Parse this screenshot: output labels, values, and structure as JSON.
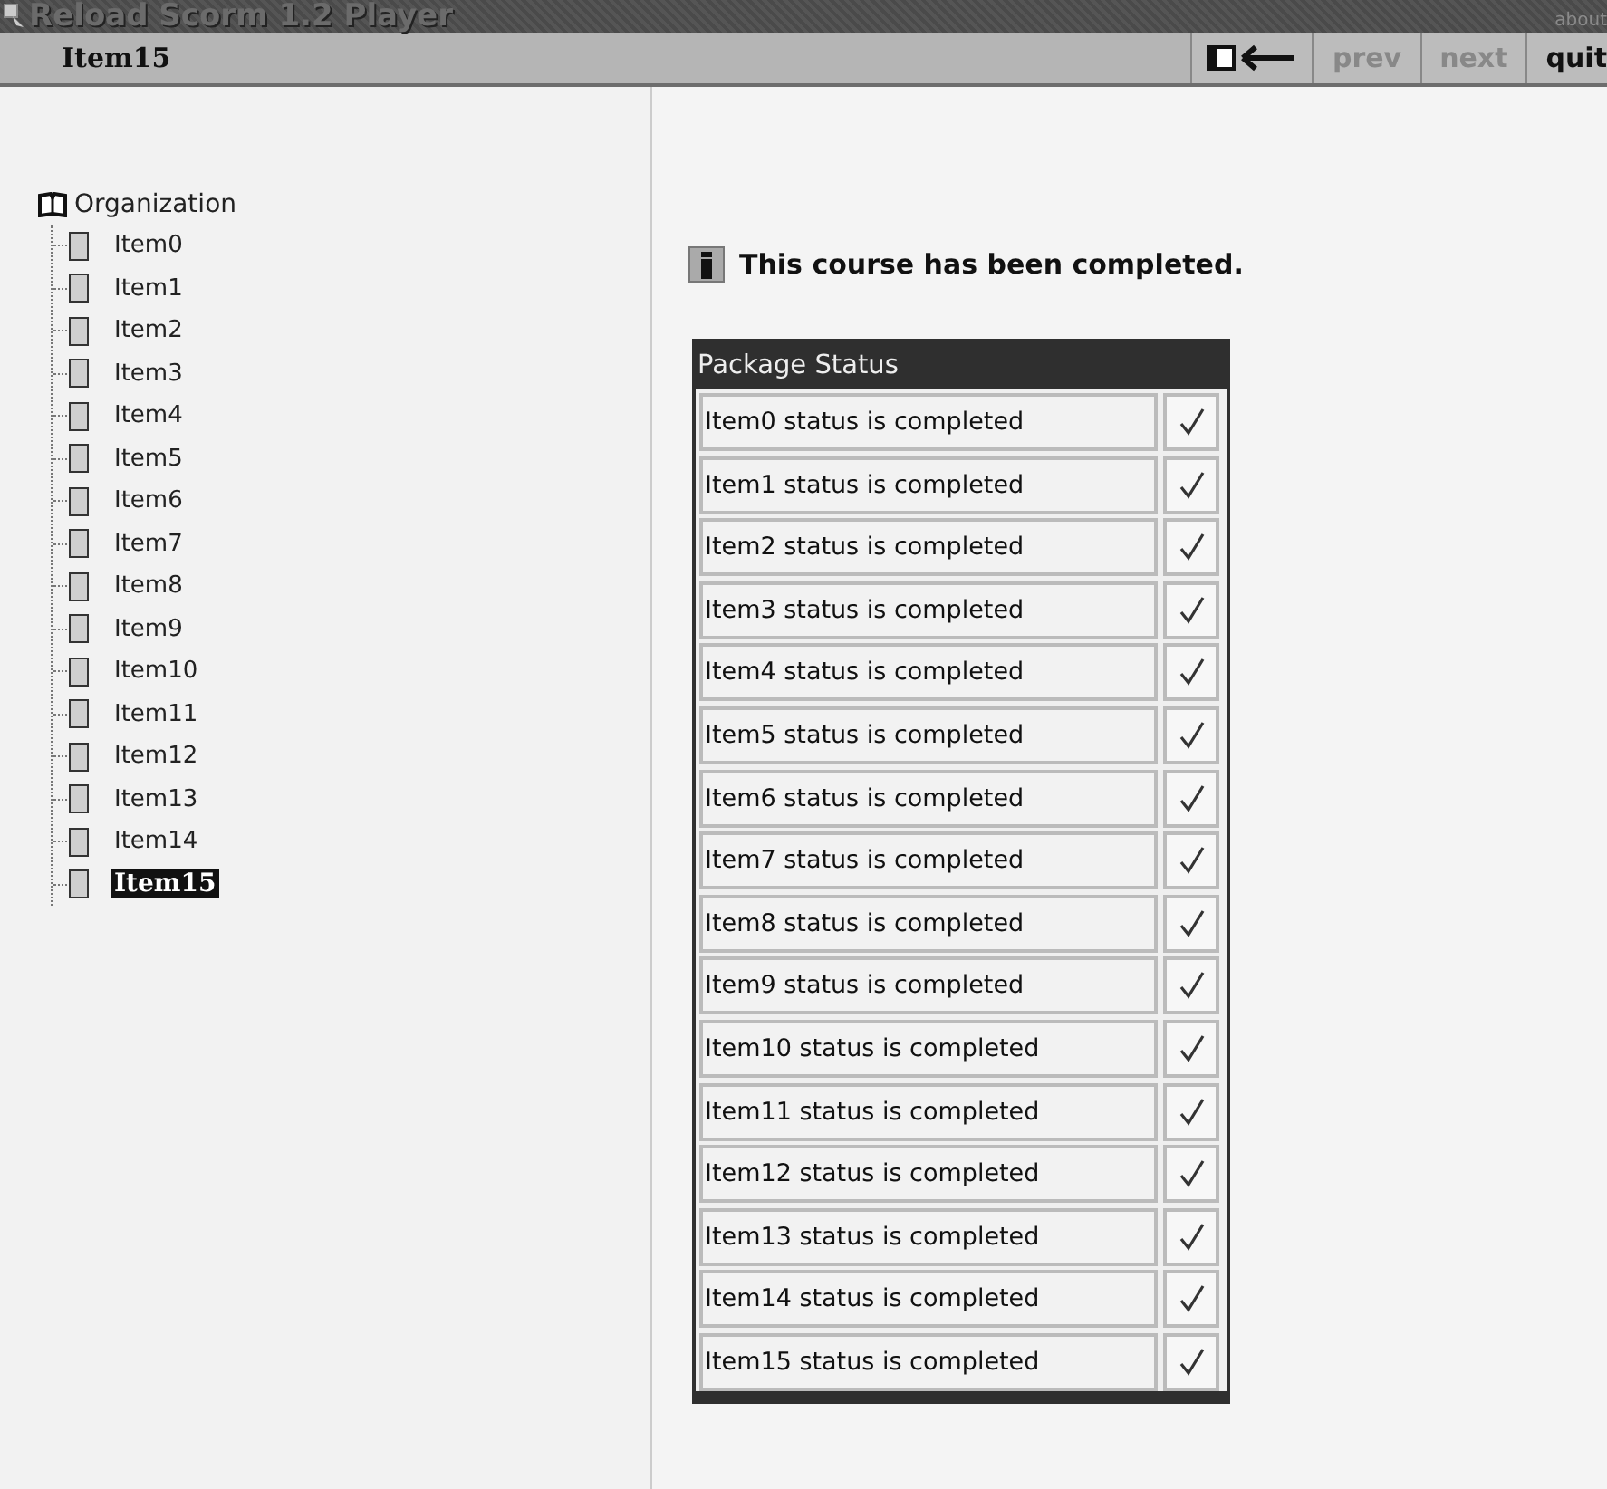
{
  "window": {
    "title": "Reload Scorm 1.2 Player",
    "about": "about"
  },
  "nav_bar": {
    "current_item": "Item15",
    "buttons": [
      "prev",
      "next",
      "quit"
    ]
  },
  "tree": {
    "label": "Organization",
    "children": [
      {
        "label": "Item0",
        "selected": false
      },
      {
        "label": "Item1",
        "selected": false
      },
      {
        "label": "Item2",
        "selected": false
      },
      {
        "label": "Item3",
        "selected": false
      },
      {
        "label": "Item4",
        "selected": false
      },
      {
        "label": "Item5",
        "selected": false
      },
      {
        "label": "Item6",
        "selected": false
      },
      {
        "label": "Item7",
        "selected": false
      },
      {
        "label": "Item8",
        "selected": false
      },
      {
        "label": "Item9",
        "selected": false
      },
      {
        "label": "Item10",
        "selected": false
      },
      {
        "label": "Item11",
        "selected": false
      },
      {
        "label": "Item12",
        "selected": false
      },
      {
        "label": "Item13",
        "selected": false
      },
      {
        "label": "Item14",
        "selected": false
      },
      {
        "label": "Item15",
        "selected": true
      }
    ]
  },
  "message": "This course has been completed.",
  "package_status": {
    "title": "Package Status",
    "rows": [
      {
        "text": "Item0 status is completed",
        "completed": true
      },
      {
        "text": "Item1 status is completed",
        "completed": true
      },
      {
        "text": "Item2 status is completed",
        "completed": true
      },
      {
        "text": "Item3 status is completed",
        "completed": true
      },
      {
        "text": "Item4 status is completed",
        "completed": true
      },
      {
        "text": "Item5 status is completed",
        "completed": true
      },
      {
        "text": "Item6 status is completed",
        "completed": true
      },
      {
        "text": "Item7 status is completed",
        "completed": true
      },
      {
        "text": "Item8 status is completed",
        "completed": true
      },
      {
        "text": "Item9 status is completed",
        "completed": true
      },
      {
        "text": "Item10 status is completed",
        "completed": true
      },
      {
        "text": "Item11 status is completed",
        "completed": true
      },
      {
        "text": "Item12 status is completed",
        "completed": true
      },
      {
        "text": "Item13 status is completed",
        "completed": true
      },
      {
        "text": "Item14 status is completed",
        "completed": true
      },
      {
        "text": "Item15 status is completed",
        "completed": true
      }
    ]
  }
}
